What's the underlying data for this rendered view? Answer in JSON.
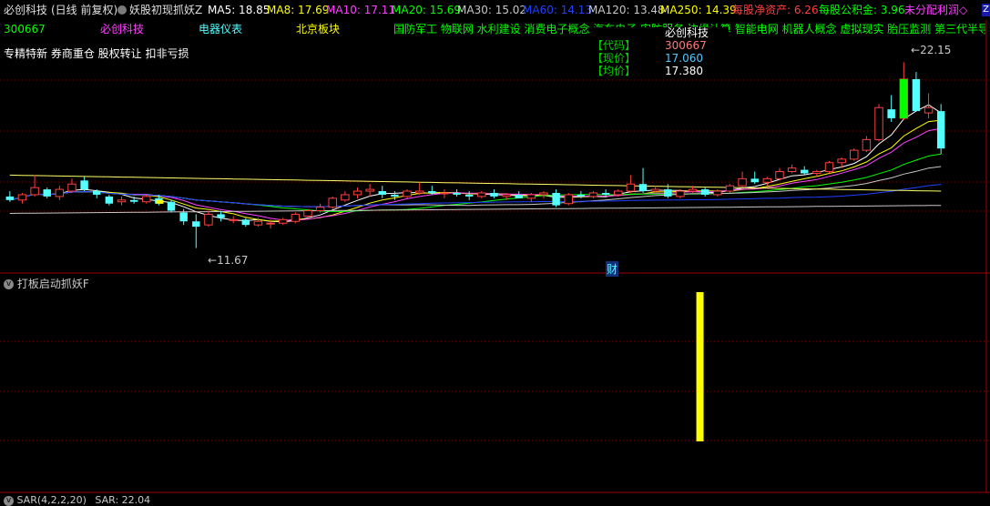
{
  "header": {
    "title": "必创科技",
    "period": "(日线 前复权)",
    "indicator_name": "妖股初现抓妖Z",
    "ma5": "MA5: 18.85",
    "ma8": "MA8: 17.69",
    "ma10": "MA10: 17.11",
    "ma20": "MA20: 15.69",
    "ma30": "MA30: 15.02",
    "ma60": "MA60: 14.13",
    "ma120": "MA120: 13.48",
    "ma250": "MA250: 14.39",
    "nav": "每股净资产: 6.26",
    "reserve": "每股公积金: 3.96",
    "undistributed": "未分配利润◇"
  },
  "info_row": {
    "code": "300667",
    "name": "必创科技",
    "industry": "电器仪表",
    "region": "北京板块",
    "concepts": "国防军工 物联网 水利建设 消费电子概念 汽车电子 安防服务 边缘计算 智能电网 机器人概念 虚拟现实 胎压监测 第三代半导"
  },
  "tags": "专精特新 券商重仓 股权转让 扣非亏损",
  "tooltip": {
    "name": "必创科技",
    "code_label": "【代码】",
    "code_value": "300667",
    "price_label": "【现价】",
    "price_value": "17.060",
    "avg_label": "【均价】",
    "avg_value": "17.380"
  },
  "high_label": "22.15",
  "low_label": "11.67",
  "finance_marker": "财",
  "sub_panel": {
    "title": "打板启动抓妖F"
  },
  "sar_panel": {
    "title": "SAR(4,2,2,20)",
    "value": "SAR: 22.04"
  },
  "colors": {
    "up": "#ff4040",
    "down": "#54ffff",
    "ma5": "#ffffff",
    "ma8": "#ffff00",
    "ma10": "#ff40ff",
    "ma20": "#00ff00",
    "ma30": "#c8c8c8",
    "ma60": "#2040ff",
    "ma120": "#c8c8c8",
    "ma250": "#c8c8c8",
    "signal_bar": "#ffff00"
  },
  "chart_data": {
    "type": "candlestick",
    "price_axis_range": [
      10.5,
      23.5
    ],
    "candles": [
      {
        "o": 14.6,
        "h": 14.9,
        "l": 14.3,
        "c": 14.4
      },
      {
        "o": 14.4,
        "h": 14.8,
        "l": 14.2,
        "c": 14.7
      },
      {
        "o": 14.7,
        "h": 15.8,
        "l": 14.6,
        "c": 15.1
      },
      {
        "o": 15.0,
        "h": 15.1,
        "l": 14.5,
        "c": 14.6
      },
      {
        "o": 14.6,
        "h": 15.2,
        "l": 14.4,
        "c": 15.0
      },
      {
        "o": 14.9,
        "h": 15.6,
        "l": 14.8,
        "c": 15.3
      },
      {
        "o": 15.5,
        "h": 15.7,
        "l": 14.9,
        "c": 15.0
      },
      {
        "o": 14.9,
        "h": 15.0,
        "l": 14.5,
        "c": 14.7
      },
      {
        "o": 14.6,
        "h": 14.7,
        "l": 14.1,
        "c": 14.2
      },
      {
        "o": 14.3,
        "h": 14.6,
        "l": 14.1,
        "c": 14.4
      },
      {
        "o": 14.4,
        "h": 14.6,
        "l": 14.2,
        "c": 14.3
      },
      {
        "o": 14.3,
        "h": 14.7,
        "l": 14.2,
        "c": 14.6
      },
      {
        "o": 14.5,
        "h": 14.7,
        "l": 14.1,
        "c": 14.2
      },
      {
        "o": 14.3,
        "h": 14.4,
        "l": 13.7,
        "c": 13.8
      },
      {
        "o": 13.7,
        "h": 13.9,
        "l": 13.0,
        "c": 13.2
      },
      {
        "o": 13.2,
        "h": 13.6,
        "l": 11.7,
        "c": 12.9
      },
      {
        "o": 13.0,
        "h": 13.8,
        "l": 12.9,
        "c": 13.6
      },
      {
        "o": 13.6,
        "h": 13.8,
        "l": 13.2,
        "c": 13.4
      },
      {
        "o": 13.3,
        "h": 13.5,
        "l": 13.1,
        "c": 13.3
      },
      {
        "o": 13.3,
        "h": 13.4,
        "l": 12.9,
        "c": 13.0
      },
      {
        "o": 13.0,
        "h": 13.4,
        "l": 12.9,
        "c": 13.2
      },
      {
        "o": 13.1,
        "h": 13.3,
        "l": 12.8,
        "c": 13.1
      },
      {
        "o": 13.1,
        "h": 13.4,
        "l": 13.0,
        "c": 13.3
      },
      {
        "o": 13.2,
        "h": 13.7,
        "l": 13.1,
        "c": 13.6
      },
      {
        "o": 13.5,
        "h": 13.9,
        "l": 13.4,
        "c": 13.8
      },
      {
        "o": 13.8,
        "h": 14.2,
        "l": 13.7,
        "c": 14.0
      },
      {
        "o": 14.0,
        "h": 14.6,
        "l": 13.9,
        "c": 14.5
      },
      {
        "o": 14.4,
        "h": 14.9,
        "l": 14.3,
        "c": 14.7
      },
      {
        "o": 14.7,
        "h": 15.1,
        "l": 14.5,
        "c": 14.9
      },
      {
        "o": 14.9,
        "h": 15.3,
        "l": 14.6,
        "c": 15.0
      },
      {
        "o": 14.9,
        "h": 15.2,
        "l": 14.5,
        "c": 14.7
      },
      {
        "o": 14.7,
        "h": 14.9,
        "l": 14.4,
        "c": 14.6
      },
      {
        "o": 14.6,
        "h": 15.0,
        "l": 14.5,
        "c": 14.9
      },
      {
        "o": 14.8,
        "h": 15.4,
        "l": 14.7,
        "c": 14.9
      },
      {
        "o": 14.9,
        "h": 15.2,
        "l": 14.7,
        "c": 14.8
      },
      {
        "o": 14.8,
        "h": 15.0,
        "l": 14.5,
        "c": 14.8
      },
      {
        "o": 14.8,
        "h": 15.0,
        "l": 14.6,
        "c": 14.7
      },
      {
        "o": 14.7,
        "h": 14.9,
        "l": 14.4,
        "c": 14.6
      },
      {
        "o": 14.6,
        "h": 14.9,
        "l": 14.5,
        "c": 14.8
      },
      {
        "o": 14.8,
        "h": 15.0,
        "l": 14.5,
        "c": 14.6
      },
      {
        "o": 14.6,
        "h": 14.8,
        "l": 14.4,
        "c": 14.7
      },
      {
        "o": 14.7,
        "h": 14.9,
        "l": 14.5,
        "c": 14.5
      },
      {
        "o": 14.5,
        "h": 14.8,
        "l": 14.3,
        "c": 14.7
      },
      {
        "o": 14.7,
        "h": 14.9,
        "l": 14.5,
        "c": 14.8
      },
      {
        "o": 14.8,
        "h": 15.0,
        "l": 14.0,
        "c": 14.1
      },
      {
        "o": 14.2,
        "h": 14.8,
        "l": 14.1,
        "c": 14.7
      },
      {
        "o": 14.7,
        "h": 14.9,
        "l": 14.5,
        "c": 14.6
      },
      {
        "o": 14.6,
        "h": 14.9,
        "l": 14.5,
        "c": 14.8
      },
      {
        "o": 14.8,
        "h": 15.0,
        "l": 14.6,
        "c": 14.7
      },
      {
        "o": 14.7,
        "h": 15.0,
        "l": 14.6,
        "c": 14.9
      },
      {
        "o": 14.9,
        "h": 15.8,
        "l": 14.8,
        "c": 15.3
      },
      {
        "o": 15.3,
        "h": 16.2,
        "l": 14.8,
        "c": 14.9
      },
      {
        "o": 14.9,
        "h": 15.2,
        "l": 14.7,
        "c": 15.0
      },
      {
        "o": 15.0,
        "h": 15.3,
        "l": 14.5,
        "c": 14.6
      },
      {
        "o": 14.6,
        "h": 15.0,
        "l": 14.5,
        "c": 14.9
      },
      {
        "o": 14.9,
        "h": 15.2,
        "l": 14.8,
        "c": 15.0
      },
      {
        "o": 15.0,
        "h": 15.1,
        "l": 14.6,
        "c": 14.7
      },
      {
        "o": 14.7,
        "h": 15.0,
        "l": 14.6,
        "c": 14.9
      },
      {
        "o": 14.9,
        "h": 15.3,
        "l": 14.8,
        "c": 15.2
      },
      {
        "o": 15.2,
        "h": 16.0,
        "l": 15.1,
        "c": 15.6
      },
      {
        "o": 15.6,
        "h": 16.0,
        "l": 15.3,
        "c": 15.4
      },
      {
        "o": 15.4,
        "h": 15.7,
        "l": 15.2,
        "c": 15.6
      },
      {
        "o": 15.6,
        "h": 16.2,
        "l": 15.5,
        "c": 16.0
      },
      {
        "o": 16.0,
        "h": 16.4,
        "l": 15.9,
        "c": 16.2
      },
      {
        "o": 16.1,
        "h": 16.3,
        "l": 15.8,
        "c": 15.9
      },
      {
        "o": 15.9,
        "h": 16.1,
        "l": 15.7,
        "c": 16.0
      },
      {
        "o": 16.0,
        "h": 16.6,
        "l": 15.9,
        "c": 16.5
      },
      {
        "o": 16.5,
        "h": 16.8,
        "l": 16.2,
        "c": 16.7
      },
      {
        "o": 16.7,
        "h": 17.3,
        "l": 16.6,
        "c": 17.2
      },
      {
        "o": 17.2,
        "h": 18.0,
        "l": 17.1,
        "c": 17.8
      },
      {
        "o": 17.8,
        "h": 19.8,
        "l": 17.7,
        "c": 19.6
      },
      {
        "o": 19.5,
        "h": 20.3,
        "l": 18.8,
        "c": 19.0
      },
      {
        "o": 19.0,
        "h": 22.15,
        "l": 18.9,
        "c": 21.2
      },
      {
        "o": 21.2,
        "h": 21.6,
        "l": 20.0,
        "c": 19.4
      },
      {
        "o": 19.3,
        "h": 20.4,
        "l": 19.0,
        "c": 19.6
      },
      {
        "o": 19.4,
        "h": 19.8,
        "l": 17.0,
        "c": 17.3
      }
    ],
    "signal": {
      "candle_index": 55,
      "value": 1
    }
  }
}
